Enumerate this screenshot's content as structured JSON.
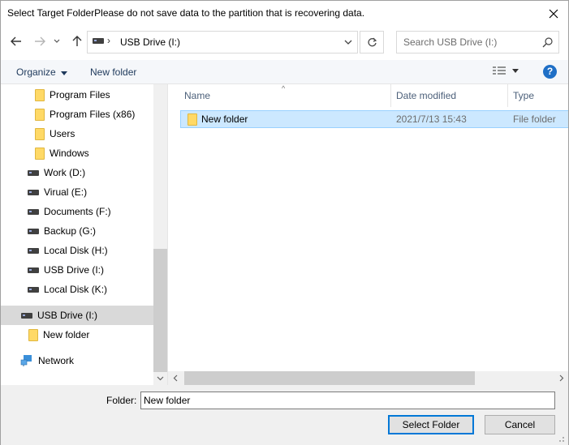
{
  "dialog": {
    "title": "Select Target FolderPlease do not save data to the partition that is recovering data."
  },
  "address": {
    "path": "USB Drive (I:)",
    "search_placeholder": "Search USB Drive (I:)"
  },
  "toolbar": {
    "organize_label": "Organize",
    "new_folder_label": "New folder",
    "help_label": "?"
  },
  "nav": {
    "items": [
      {
        "label": "Program Files",
        "icon": "folder-icon"
      },
      {
        "label": "Program Files (x86)",
        "icon": "folder-icon"
      },
      {
        "label": "Users",
        "icon": "folder-icon"
      },
      {
        "label": "Windows",
        "icon": "folder-icon"
      },
      {
        "label": "Work (D:)",
        "icon": "drive-icon"
      },
      {
        "label": "Virual (E:)",
        "icon": "drive-icon"
      },
      {
        "label": "Documents (F:)",
        "icon": "drive-icon"
      },
      {
        "label": "Backup (G:)",
        "icon": "drive-icon"
      },
      {
        "label": "Local Disk (H:)",
        "icon": "drive-icon"
      },
      {
        "label": "USB Drive (I:)",
        "icon": "drive-icon"
      },
      {
        "label": "Local Disk (K:)",
        "icon": "drive-icon"
      },
      {
        "label": "USB Drive (I:)",
        "icon": "drive-icon",
        "selected": true
      },
      {
        "label": "New folder",
        "icon": "folder-icon"
      },
      {
        "label": "Network",
        "icon": "network-icon"
      }
    ]
  },
  "files": {
    "columns": [
      "Name",
      "Date modified",
      "Type"
    ],
    "rows": [
      {
        "name": "New folder",
        "date": "2021/7/13 15:43",
        "type": "File folder"
      }
    ]
  },
  "bottom": {
    "folder_label": "Folder:",
    "folder_value": "New folder",
    "select_label": "Select Folder",
    "cancel_label": "Cancel"
  },
  "colors": {
    "selection": "#cce8ff",
    "accent": "#0078d7",
    "folder": "#ffd966"
  }
}
